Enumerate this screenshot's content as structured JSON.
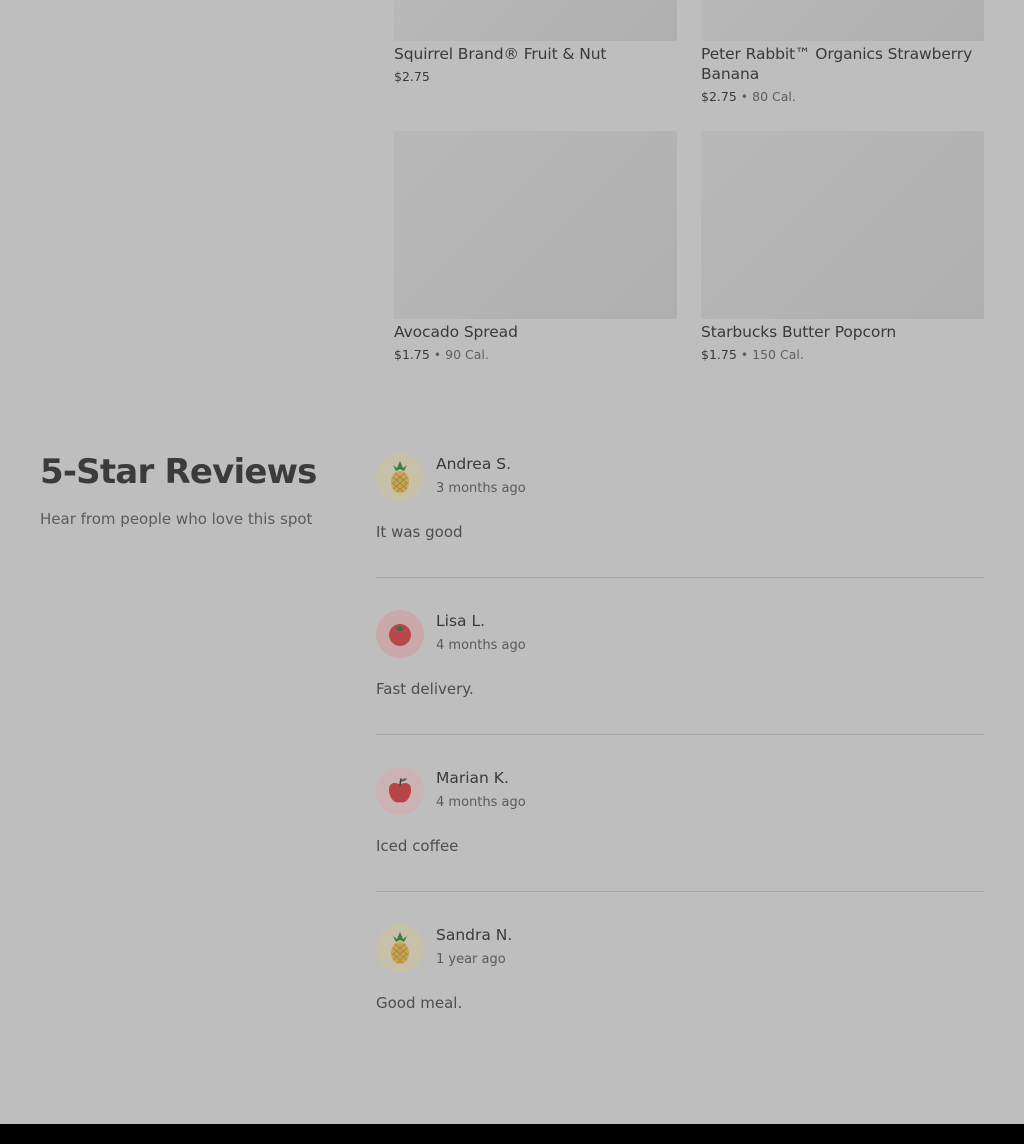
{
  "products": [
    {
      "name": "Squirrel Brand® Fruit & Nut",
      "price": "$2.75",
      "separator": "",
      "calories": ""
    },
    {
      "name": "Peter Rabbit™ Organics Strawberry Banana",
      "price": "$2.75",
      "separator": "•",
      "calories": "80 Cal."
    },
    {
      "name": "Avocado Spread",
      "price": "$1.75",
      "separator": "•",
      "calories": "90 Cal."
    },
    {
      "name": "Starbucks Butter Popcorn",
      "price": "$1.75",
      "separator": "•",
      "calories": "150 Cal."
    }
  ],
  "reviews_section": {
    "title": "5-Star Reviews",
    "subtitle": "Hear from people who love this spot",
    "reviews": [
      {
        "author": "Andrea S.",
        "time": "3 months ago",
        "text": "It was good",
        "avatar_icon": "pineapple-icon",
        "avatar_bg": "#c7c1aa"
      },
      {
        "author": "Lisa L.",
        "time": "4 months ago",
        "text": "Fast delivery.",
        "avatar_icon": "tomato-icon",
        "avatar_bg": "#c9a9aa"
      },
      {
        "author": "Marian K.",
        "time": "4 months ago",
        "text": "Iced coffee",
        "avatar_icon": "apple-icon",
        "avatar_bg": "#cbb3b3"
      },
      {
        "author": "Sandra N.",
        "time": "1 year ago",
        "text": "Good meal.",
        "avatar_icon": "pineapple-icon",
        "avatar_bg": "#c7c1aa"
      }
    ]
  }
}
